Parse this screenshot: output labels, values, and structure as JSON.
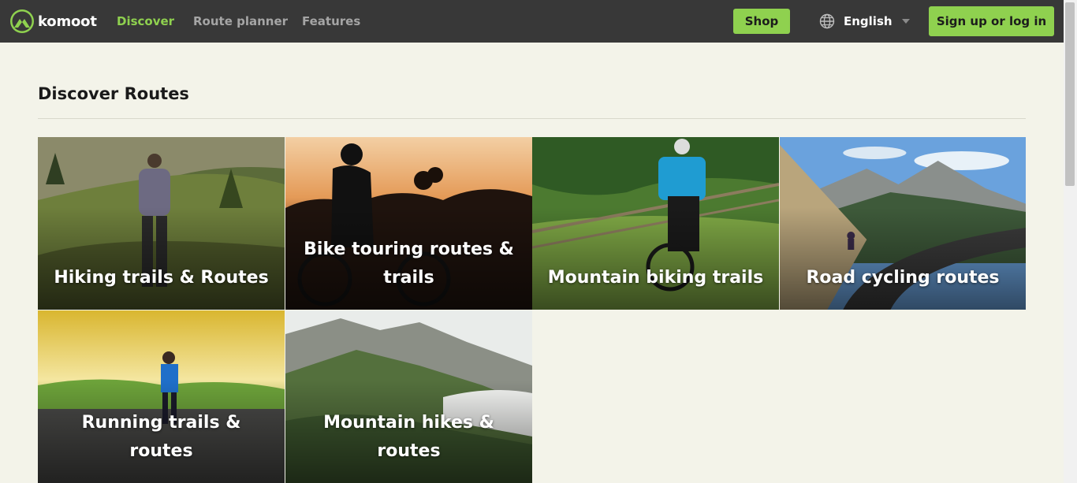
{
  "header": {
    "brand": "komoot",
    "nav": {
      "discover": "Discover",
      "route_planner": "Route planner",
      "features": "Features"
    },
    "shop_label": "Shop",
    "language": "English",
    "signup_label": "Sign up or log in"
  },
  "main": {
    "title": "Discover Routes",
    "tiles": [
      {
        "label": "Hiking trails & Routes"
      },
      {
        "label": "Bike touring routes & trails"
      },
      {
        "label": "Mountain biking trails"
      },
      {
        "label": "Road cycling routes"
      },
      {
        "label": "Running trails & routes"
      },
      {
        "label": "Mountain hikes & routes"
      }
    ]
  },
  "colors": {
    "accent": "#8fd14f",
    "header_bg": "#383838",
    "page_bg": "#f3f3e9"
  },
  "icons": [
    "komoot-logo-icon",
    "globe-icon",
    "chevron-down-icon"
  ]
}
